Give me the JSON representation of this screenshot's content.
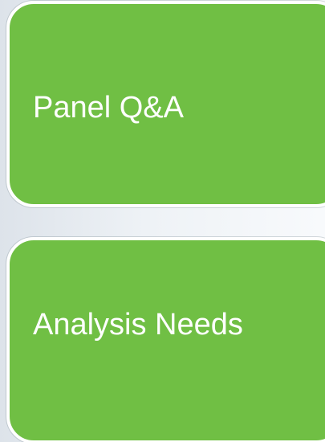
{
  "colors": {
    "card_fill": "#70bf44",
    "card_border": "#ffffff",
    "text": "#ffffff",
    "background": "#eef2f6"
  },
  "cards": [
    {
      "label": "Panel Q&A"
    },
    {
      "label": "Analysis Needs"
    }
  ]
}
